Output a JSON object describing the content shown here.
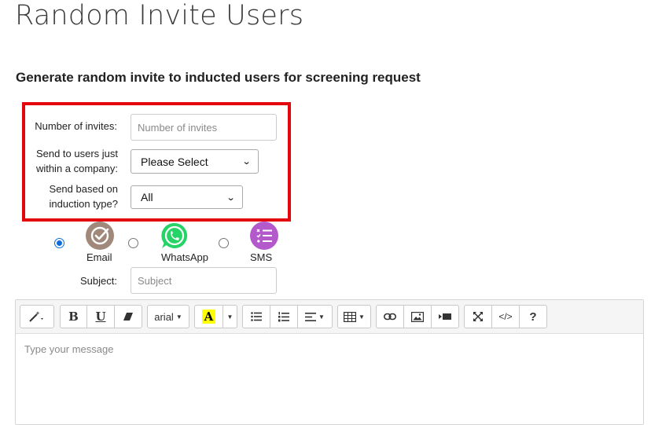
{
  "page": {
    "title": "Random Invite Users",
    "subtitle": "Generate random invite to inducted users for screening request"
  },
  "form": {
    "invites_label": "Number of invites:",
    "invites_placeholder": "Number of invites",
    "company_label_line1": "Send to users just",
    "company_label_line2": "within a company:",
    "company_selected": "Please Select",
    "induction_label_line1": "Send based on",
    "induction_label_line2": "induction type?",
    "induction_selected": "All",
    "subject_label": "Subject:",
    "subject_placeholder": "Subject"
  },
  "channels": [
    {
      "label": "Email",
      "selected": true,
      "icon": "email-check-icon",
      "color": "#a0897a"
    },
    {
      "label": "WhatsApp",
      "selected": false,
      "icon": "whatsapp-icon",
      "color": "#25d366"
    },
    {
      "label": "SMS",
      "selected": false,
      "icon": "sms-list-icon",
      "color": "#b459cc"
    }
  ],
  "editor": {
    "font_name": "arial",
    "placeholder": "Type your message",
    "toolbar_icons": [
      "magic-wand-icon",
      "bold-icon",
      "underline-icon",
      "eraser-icon",
      "font-family-dropdown",
      "text-color-icon",
      "text-color-dropdown",
      "unordered-list-icon",
      "ordered-list-icon",
      "paragraph-align-icon",
      "table-icon",
      "link-icon",
      "picture-icon",
      "video-icon",
      "fullscreen-icon",
      "code-view-icon",
      "help-icon"
    ],
    "bold_glyph": "B",
    "underline_glyph": "U",
    "color_glyph": "A",
    "code_glyph": "</>",
    "help_glyph": "?"
  },
  "colors": {
    "highlight_border": "#e3060d",
    "radio_checked": "#0b6ed8"
  }
}
